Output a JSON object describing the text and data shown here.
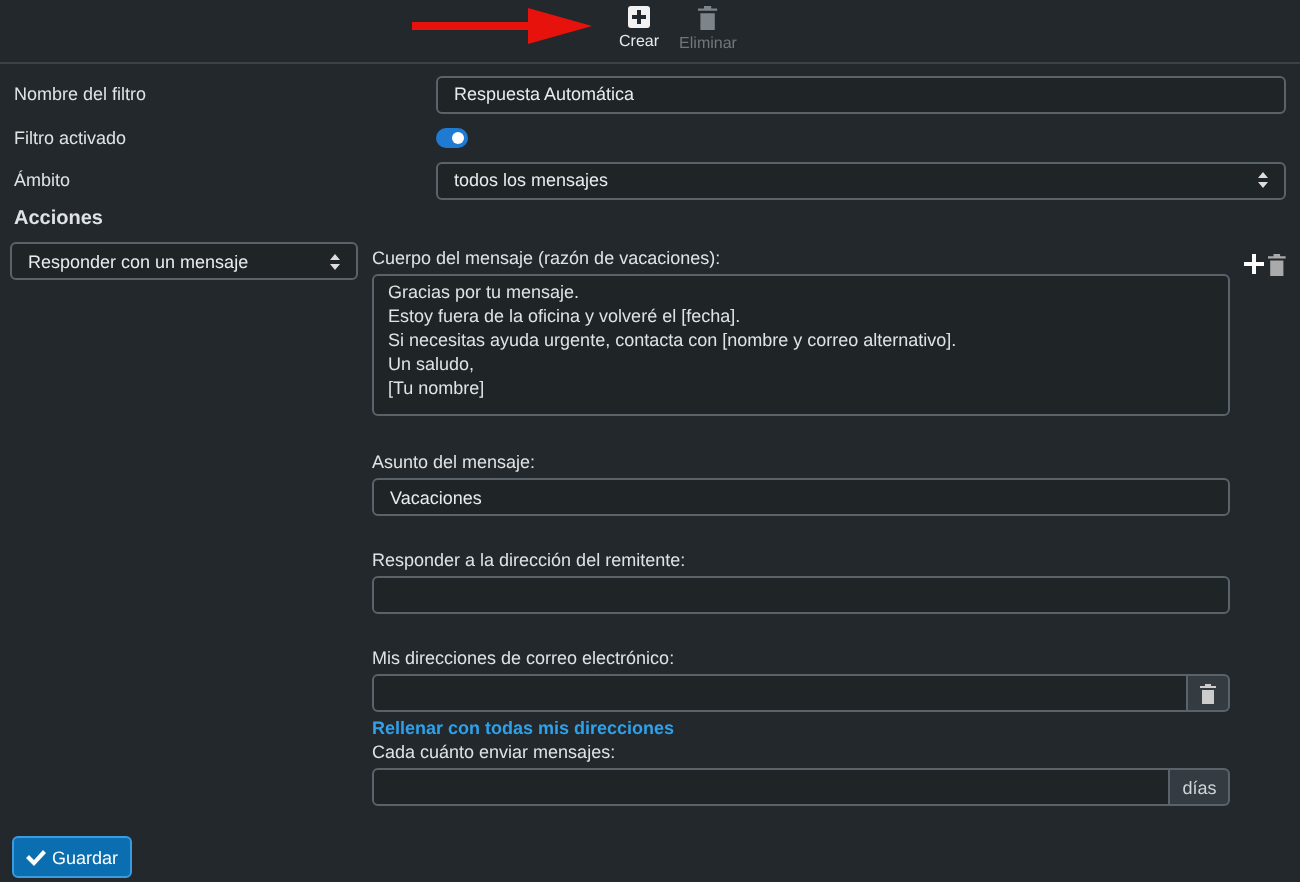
{
  "toolbar": [
    {
      "label": "Crear",
      "disabled": false
    },
    {
      "label": "Eliminar",
      "disabled": true
    }
  ],
  "filter_name": {
    "label": "Nombre del filtro",
    "value": "Respuesta Automática"
  },
  "filter_enabled": {
    "label": "Filtro activado",
    "on": true
  },
  "scope": {
    "label": "Ámbito",
    "value": "todos los mensajes"
  },
  "actions_heading": "Acciones",
  "action_select": {
    "value": "Responder con un mensaje"
  },
  "body": {
    "label": "Cuerpo del mensaje (razón de vacaciones):",
    "lines": [
      "Gracias por tu mensaje.",
      "Estoy fuera de la oficina y volveré el [fecha].",
      "Si necesitas ayuda urgente, contacta con [nombre y correo alternativo].",
      "Un saludo,",
      "[Tu nombre]"
    ]
  },
  "subject": {
    "label": "Asunto del mensaje:",
    "value": "Vacaciones"
  },
  "reply_to": {
    "label": "Responder a la dirección del remitente:"
  },
  "my_addresses": {
    "label": "Mis direcciones de correo electrónico:",
    "link": "Rellenar con todas mis direcciones"
  },
  "frequency": {
    "label": "Cada cuánto enviar mensajes:",
    "unit": "días"
  },
  "save_button": "Guardar"
}
